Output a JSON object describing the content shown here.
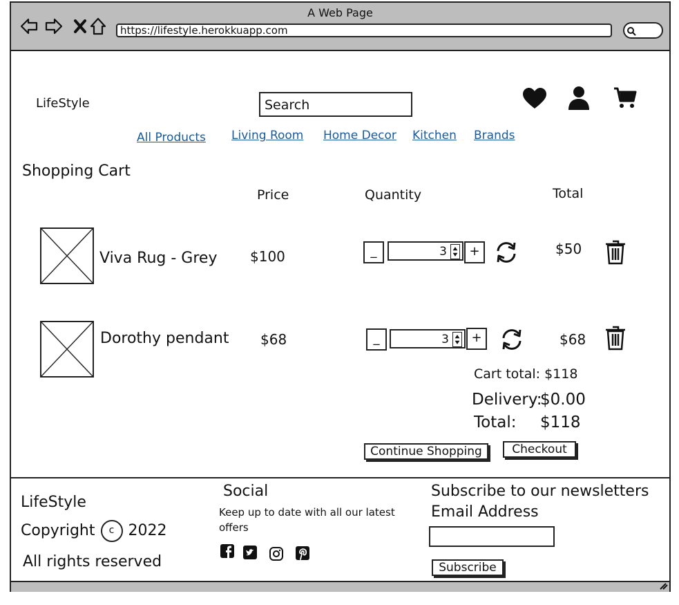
{
  "window": {
    "title": "A Web Page",
    "url": "https://lifestyle.herokkuapp.com"
  },
  "header": {
    "logo": "LifeStyle",
    "search_placeholder": "Search",
    "icons": [
      "heart-icon",
      "user-icon",
      "cart-icon"
    ]
  },
  "nav": {
    "links": [
      "All Products",
      "Living Room",
      "Home Decor",
      "Kitchen",
      "Brands"
    ]
  },
  "cart": {
    "heading": "Shopping Cart",
    "columns": {
      "price": "Price",
      "quantity": "Quantity",
      "total": "Total"
    },
    "items": [
      {
        "name": "Viva Rug - Grey",
        "price": "$100",
        "qty": "3",
        "total": "$50"
      },
      {
        "name": "Dorothy pendant",
        "price": "$68",
        "qty": "3",
        "total": "$68"
      }
    ],
    "minus_label": "_",
    "plus_label": "+",
    "summary": {
      "cart_total": "Cart total: $118",
      "delivery_label": "Delivery:",
      "delivery_value": "$0.00",
      "total_label": "Total:",
      "total_value": "$118"
    },
    "continue_label": "Continue Shopping",
    "checkout_label": "Checkout"
  },
  "footer": {
    "brand": "LifeStyle",
    "copyright_prefix": "Copyright",
    "copyright_symbol": "c",
    "copyright_year": "2022",
    "rights": "All rights reserved",
    "social_heading": "Social",
    "social_text": "Keep up to date with all our latest offers",
    "social_icons": [
      "facebook-icon",
      "twitter-icon",
      "instagram-icon",
      "pinterest-icon"
    ],
    "subscribe_heading": "Subscribe to our newsletters",
    "email_label": "Email Address",
    "subscribe_label": "Subscribe"
  }
}
